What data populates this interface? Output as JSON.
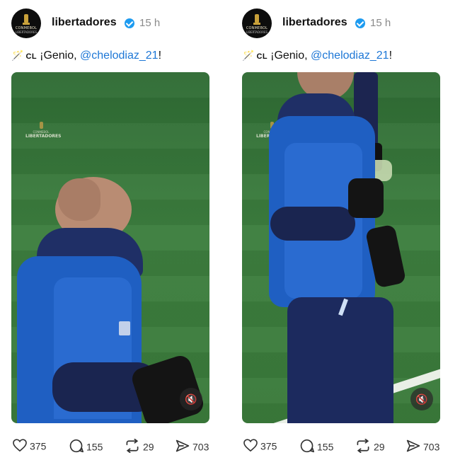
{
  "posts": [
    {
      "account": "libertadores",
      "time": "15 h",
      "avatar_text": [
        "CONMEBOL",
        "LIBERTADORES"
      ],
      "caption": {
        "flag": "CL",
        "text": "¡Genio, ",
        "mention": "@chelodiaz_21",
        "suffix": "!"
      },
      "watermark": [
        "CONMEBOL",
        "LIBERTADORES"
      ],
      "metrics": {
        "likes": "375",
        "replies": "155",
        "reposts": "29",
        "views": "703"
      }
    },
    {
      "account": "libertadores",
      "time": "15 h",
      "avatar_text": [
        "CONMEBOL",
        "LIBERTADORES"
      ],
      "caption": {
        "flag": "CL",
        "text": "¡Genio, ",
        "mention": "@chelodiaz_21",
        "suffix": "!"
      },
      "watermark": [
        "CONMEBOL",
        "LIBERTADORES"
      ],
      "metrics": {
        "likes": "375",
        "replies": "155",
        "reposts": "29",
        "views": "703"
      }
    }
  ],
  "icons": {
    "wand": "magic-wand-icon",
    "verified": "verified-badge-icon",
    "mute": "speaker-muted-icon",
    "like": "heart-icon",
    "reply": "comment-icon",
    "repost": "repost-icon",
    "share": "send-icon"
  },
  "colors": {
    "mention": "#1d77d6",
    "verified": "#1d9bf0",
    "jacket": "#1f5fc2"
  }
}
